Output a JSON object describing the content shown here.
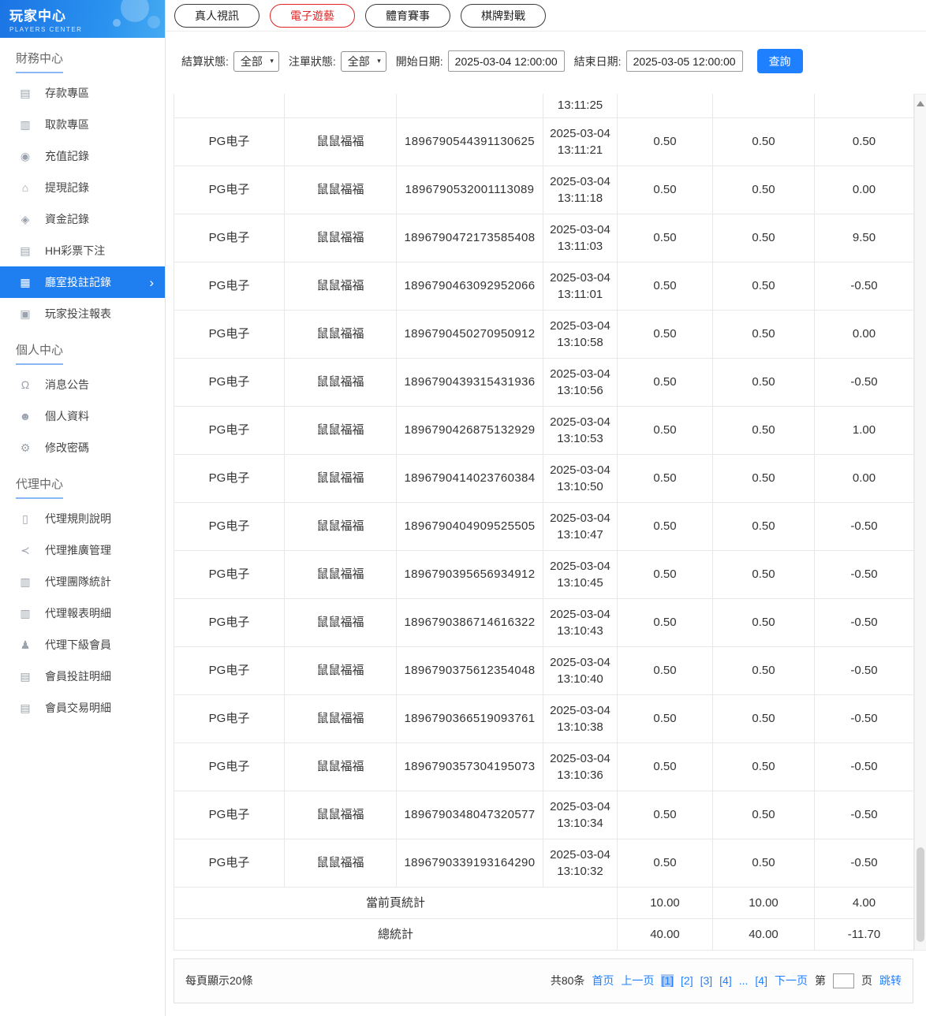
{
  "colors": {
    "accent": "#1e80ff",
    "active_tab_red": "#e02222",
    "sidebar_active_blue": "#1f7ef0"
  },
  "sidebar": {
    "title": "玩家中心",
    "subtitle": "PLAYERS CENTER",
    "sections": [
      {
        "label": "財務中心",
        "items": [
          {
            "id": "deposit",
            "label": "存款專區",
            "icon": "deposit-card-icon",
            "active": false
          },
          {
            "id": "withdraw",
            "label": "取款專區",
            "icon": "withdraw-coins-icon",
            "active": false
          },
          {
            "id": "recharge-records",
            "label": "充值記錄",
            "icon": "recharge-icon",
            "active": false
          },
          {
            "id": "cashout-records",
            "label": "提現記錄",
            "icon": "cashout-icon",
            "active": false
          },
          {
            "id": "funds-records",
            "label": "資金記錄",
            "icon": "money-bag-icon",
            "active": false
          },
          {
            "id": "hh-lottery-bets",
            "label": "HH彩票下注",
            "icon": "lottery-list-icon",
            "active": false
          },
          {
            "id": "hall-bet-records",
            "label": "廳室投註記錄",
            "icon": "grid-icon",
            "active": true
          },
          {
            "id": "player-bet-report",
            "label": "玩家投注報表",
            "icon": "report-icon",
            "active": false
          }
        ]
      },
      {
        "label": "個人中心",
        "items": [
          {
            "id": "announcements",
            "label": "消息公告",
            "icon": "bell-icon",
            "active": false
          },
          {
            "id": "profile",
            "label": "個人資料",
            "icon": "user-icon",
            "active": false
          },
          {
            "id": "change-password",
            "label": "修改密碼",
            "icon": "gear-icon",
            "active": false
          }
        ]
      },
      {
        "label": "代理中心",
        "items": [
          {
            "id": "agent-rules",
            "label": "代理規則說明",
            "icon": "document-icon",
            "active": false
          },
          {
            "id": "agent-promotion",
            "label": "代理推廣管理",
            "icon": "share-icon",
            "active": false
          },
          {
            "id": "agent-team-stats",
            "label": "代理團隊統計",
            "icon": "ledger-icon",
            "active": false
          },
          {
            "id": "agent-report-detail",
            "label": "代理報表明細",
            "icon": "ledger-icon",
            "active": false
          },
          {
            "id": "agent-sub-members",
            "label": "代理下級會員",
            "icon": "users-icon",
            "active": false
          },
          {
            "id": "member-bet-detail",
            "label": "會員投註明細",
            "icon": "list-icon",
            "active": false
          },
          {
            "id": "member-transaction-detail",
            "label": "會員交易明細",
            "icon": "list-icon",
            "active": false
          }
        ]
      }
    ]
  },
  "tabs": [
    {
      "id": "live-casino",
      "label": "真人視訊",
      "active": false
    },
    {
      "id": "electronic-games",
      "label": "電子遊藝",
      "active": true
    },
    {
      "id": "sports",
      "label": "體育賽事",
      "active": false
    },
    {
      "id": "board-games",
      "label": "棋牌對戰",
      "active": false
    }
  ],
  "filters": {
    "settle_label": "結算狀態:",
    "settle_value": "全部",
    "order_label": "注單狀態:",
    "order_value": "全部",
    "start_label": "開始日期:",
    "start_value": "2025-03-04 12:00:00",
    "end_label": "結束日期:",
    "end_value": "2025-03-05 12:00:00",
    "search_label": "查詢"
  },
  "table": {
    "columns": [
      "provider",
      "game-name",
      "order-id",
      "bet-time",
      "bet-amount",
      "valid-bet",
      "win-loss"
    ],
    "partial_row_time": "13:11:25",
    "rows": [
      [
        "PG电子",
        "鼠鼠福福",
        "1896790544391130625",
        "2025-03-04 13:11:21",
        "0.50",
        "0.50",
        "0.50"
      ],
      [
        "PG电子",
        "鼠鼠福福",
        "1896790532001113089",
        "2025-03-04 13:11:18",
        "0.50",
        "0.50",
        "0.00"
      ],
      [
        "PG电子",
        "鼠鼠福福",
        "1896790472173585408",
        "2025-03-04 13:11:03",
        "0.50",
        "0.50",
        "9.50"
      ],
      [
        "PG电子",
        "鼠鼠福福",
        "1896790463092952066",
        "2025-03-04 13:11:01",
        "0.50",
        "0.50",
        "-0.50"
      ],
      [
        "PG电子",
        "鼠鼠福福",
        "1896790450270950912",
        "2025-03-04 13:10:58",
        "0.50",
        "0.50",
        "0.00"
      ],
      [
        "PG电子",
        "鼠鼠福福",
        "1896790439315431936",
        "2025-03-04 13:10:56",
        "0.50",
        "0.50",
        "-0.50"
      ],
      [
        "PG电子",
        "鼠鼠福福",
        "1896790426875132929",
        "2025-03-04 13:10:53",
        "0.50",
        "0.50",
        "1.00"
      ],
      [
        "PG电子",
        "鼠鼠福福",
        "1896790414023760384",
        "2025-03-04 13:10:50",
        "0.50",
        "0.50",
        "0.00"
      ],
      [
        "PG电子",
        "鼠鼠福福",
        "1896790404909525505",
        "2025-03-04 13:10:47",
        "0.50",
        "0.50",
        "-0.50"
      ],
      [
        "PG电子",
        "鼠鼠福福",
        "1896790395656934912",
        "2025-03-04 13:10:45",
        "0.50",
        "0.50",
        "-0.50"
      ],
      [
        "PG电子",
        "鼠鼠福福",
        "1896790386714616322",
        "2025-03-04 13:10:43",
        "0.50",
        "0.50",
        "-0.50"
      ],
      [
        "PG电子",
        "鼠鼠福福",
        "1896790375612354048",
        "2025-03-04 13:10:40",
        "0.50",
        "0.50",
        "-0.50"
      ],
      [
        "PG电子",
        "鼠鼠福福",
        "1896790366519093761",
        "2025-03-04 13:10:38",
        "0.50",
        "0.50",
        "-0.50"
      ],
      [
        "PG电子",
        "鼠鼠福福",
        "1896790357304195073",
        "2025-03-04 13:10:36",
        "0.50",
        "0.50",
        "-0.50"
      ],
      [
        "PG电子",
        "鼠鼠福福",
        "1896790348047320577",
        "2025-03-04 13:10:34",
        "0.50",
        "0.50",
        "-0.50"
      ],
      [
        "PG电子",
        "鼠鼠福福",
        "1896790339193164290",
        "2025-03-04 13:10:32",
        "0.50",
        "0.50",
        "-0.50"
      ]
    ],
    "page_summary": {
      "label": "當前頁統計",
      "values": [
        "10.00",
        "10.00",
        "4.00"
      ]
    },
    "total_summary": {
      "label": "總統計",
      "values": [
        "40.00",
        "40.00",
        "-11.70"
      ]
    }
  },
  "footer": {
    "page_size_text": "每頁顯示20條",
    "total_text": "共80条",
    "first_label": "首页",
    "prev_label": "上一页",
    "pages": [
      {
        "label": "[1]",
        "current": true,
        "ellipsis": false
      },
      {
        "label": "[2]",
        "current": false,
        "ellipsis": false
      },
      {
        "label": "[3]",
        "current": false,
        "ellipsis": false
      },
      {
        "label": "[4]",
        "current": false,
        "ellipsis": false
      },
      {
        "label": "...",
        "current": false,
        "ellipsis": true
      },
      {
        "label": "[4]",
        "current": false,
        "ellipsis": false
      }
    ],
    "next_label": "下一页",
    "jump_prefix": "第",
    "jump_value": "",
    "jump_suffix": "页",
    "jump_label": "跳转"
  }
}
